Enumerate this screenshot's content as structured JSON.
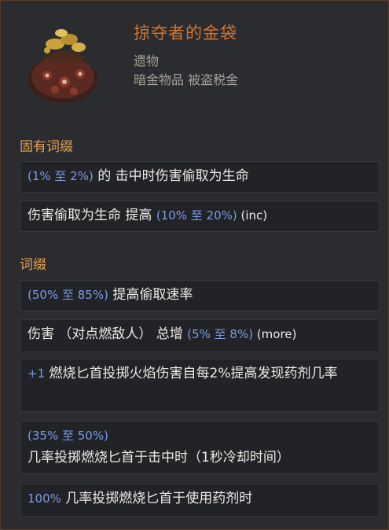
{
  "item": {
    "title": "掠夺者的金袋",
    "subtitle1": "遗物",
    "subtitle2": "暗金物品 被盗税金",
    "icon": "coin-bag-icon"
  },
  "implicit": {
    "section_label": "固有词缀",
    "mods": [
      {
        "range": "(1% 至 2%)",
        "text": " 的 击中时伤害偷取为生命"
      },
      {
        "text": "伤害偷取为生命 提高 ",
        "range": "(10% 至 20%)",
        "tag": " (inc)"
      }
    ]
  },
  "affixes": {
    "section_label": "词缀",
    "mods": [
      {
        "range": "(50% 至 85%)",
        "text": " 提高偷取速率"
      },
      {
        "text": "伤害 （对点燃敌人） 总增 ",
        "range": "(5% 至 8%)",
        "tag": " (more)"
      },
      {
        "range": "+1",
        "text": " 燃烧匕首投掷火焰伤害自每2%提高发现药剂几率"
      },
      {
        "range": "(35% 至 50%)",
        "text": " 几率投掷燃烧匕首于击中时（1秒冷却时间）"
      },
      {
        "range": "100%",
        "text": " 几率投掷燃烧匕首于使用药剂时"
      }
    ]
  },
  "colors": {
    "title": "#d8742c",
    "section": "#e1a255",
    "range": "#7b9ce6",
    "border": "#5a3a24"
  }
}
